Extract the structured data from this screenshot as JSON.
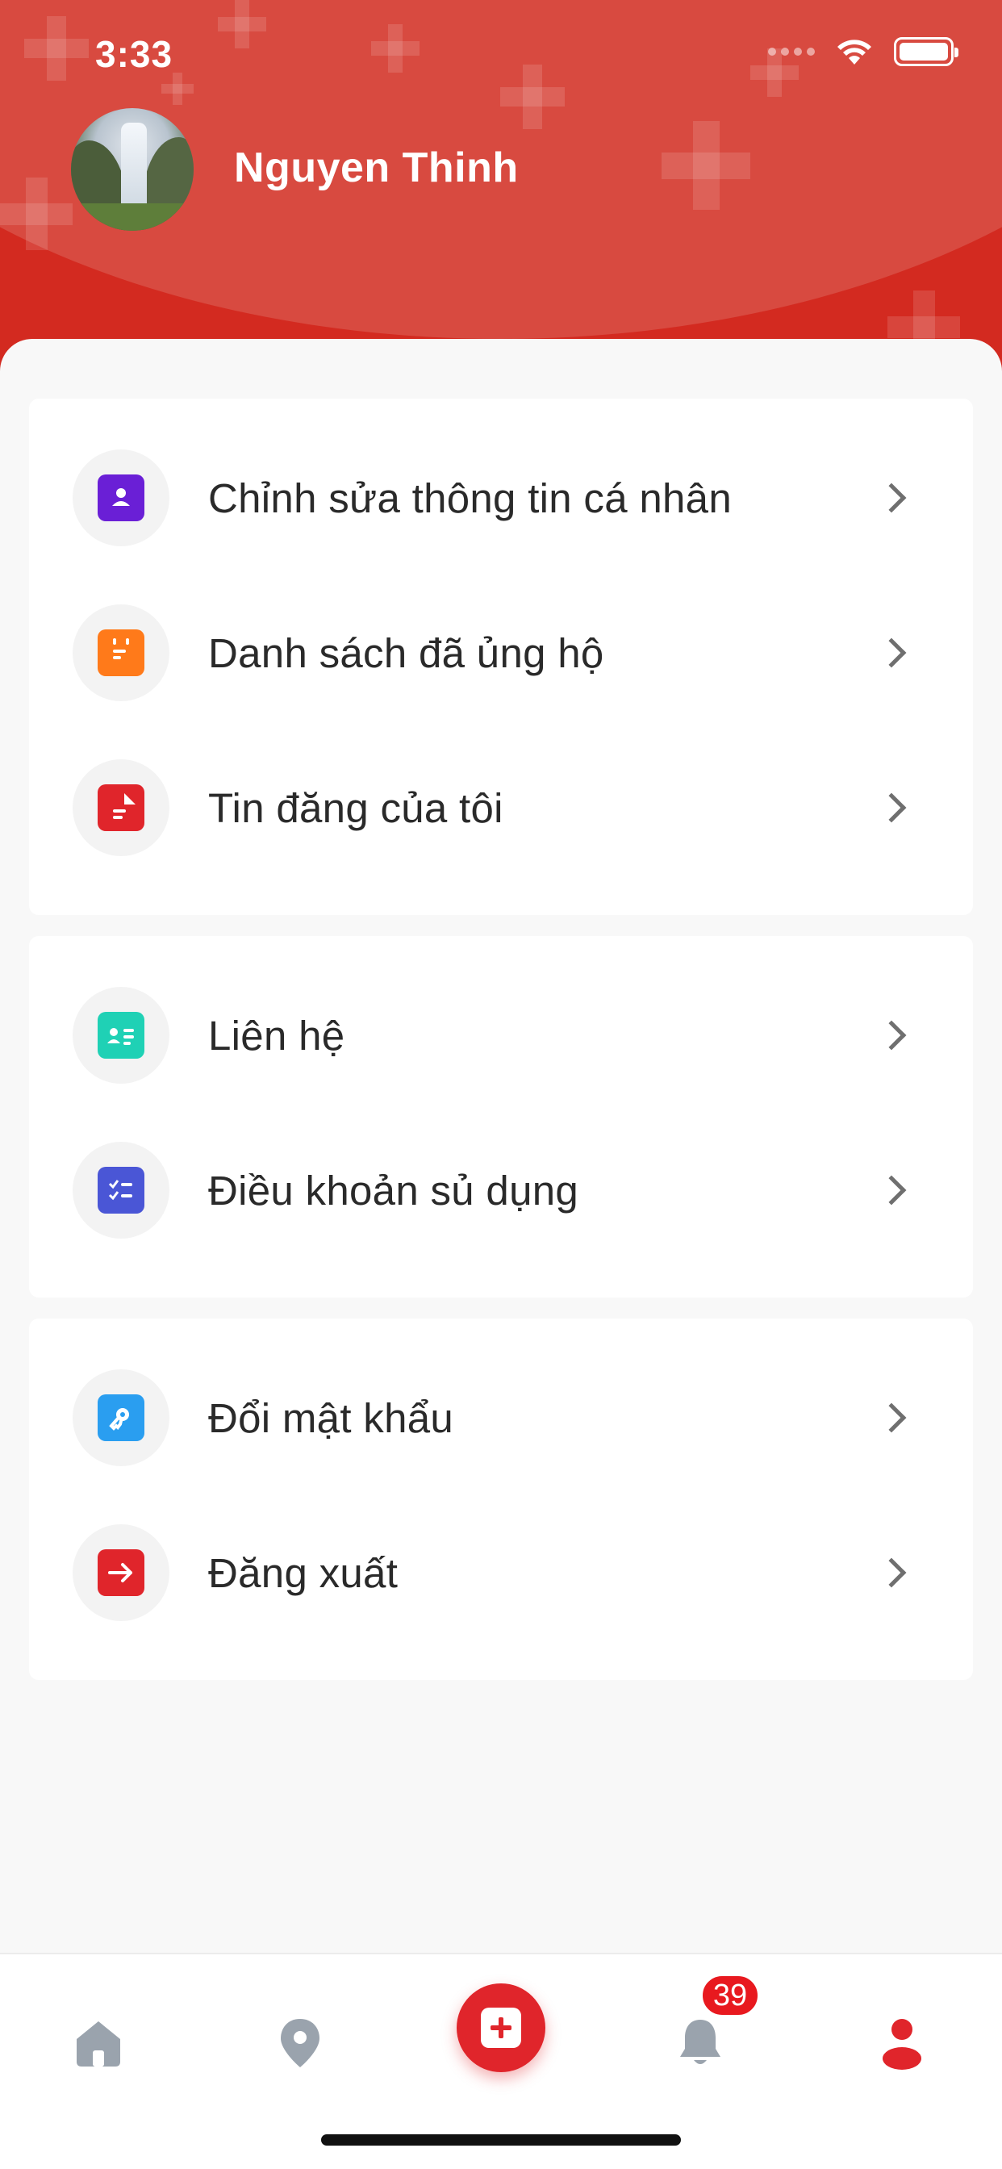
{
  "status_bar": {
    "time": "3:33"
  },
  "profile": {
    "name": "Nguyen Thinh"
  },
  "menu_groups": [
    {
      "items": [
        {
          "label": "Chỉnh sửa thông tin cá nhân",
          "icon": "user-profile-icon",
          "color": "#6a1fd6"
        },
        {
          "label": "Danh sách đã ủng hộ",
          "icon": "calendar-list-icon",
          "color": "#ff7a1a"
        },
        {
          "label": "Tin đăng của tôi",
          "icon": "document-icon",
          "color": "#e0252b"
        }
      ]
    },
    {
      "items": [
        {
          "label": "Liên hệ",
          "icon": "contact-card-icon",
          "color": "#1fd1b5"
        },
        {
          "label": "Điều khoản sủ dụng",
          "icon": "checklist-icon",
          "color": "#4a56d6"
        }
      ]
    },
    {
      "items": [
        {
          "label": "Đổi mật khẩu",
          "icon": "key-icon",
          "color": "#2a9ef0"
        },
        {
          "label": "Đăng xuất",
          "icon": "logout-icon",
          "color": "#e0252b"
        }
      ]
    }
  ],
  "tab_bar": {
    "tabs": [
      "home-icon",
      "location-pin-icon",
      "add-post-icon",
      "bell-icon",
      "profile-icon"
    ],
    "notification_badge": "39",
    "active_color": "#e0252b",
    "inactive_color": "#9aa3ad"
  }
}
